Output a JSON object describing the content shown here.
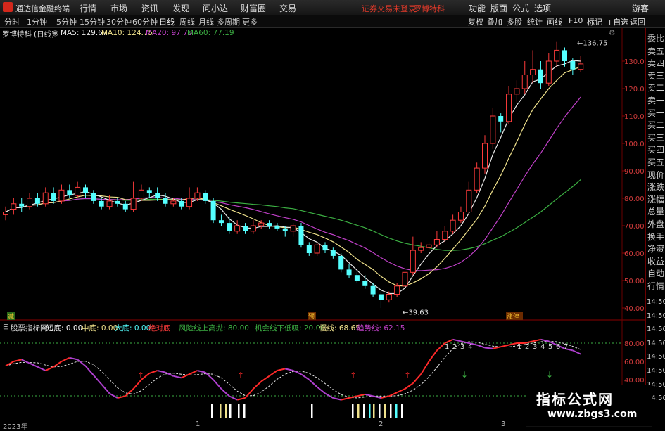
{
  "titlebar": {
    "app_name": "通达信金融终端",
    "menus": [
      "行情",
      "市场",
      "资讯",
      "发现",
      "问小达",
      "财富圈",
      "交易"
    ],
    "status_text": "证券交易未登录",
    "stock_name": "罗博特科",
    "right_menus": [
      "功能",
      "版面",
      "公式",
      "选项"
    ],
    "user": "游客"
  },
  "periods": [
    "分时",
    "1分钟",
    "5分钟",
    "15分钟",
    "30分钟",
    "60分钟",
    "日线",
    "周线",
    "月线",
    "多周期",
    "更多"
  ],
  "active_period": "日线",
  "right_tools": [
    "复权",
    "叠加",
    "多股",
    "统计",
    "画线",
    "F10",
    "标记",
    "+自选",
    "返回"
  ],
  "ma_header": {
    "stock": "罗博特科",
    "period": "(日线)",
    "ma5": "MA5: 129.67",
    "ma10": "MA10: 124.75",
    "ma20": "MA20: 97.75",
    "ma60": "MA60: 77.19"
  },
  "colors": {
    "up": "#ff3b3b",
    "down": "#54ffff",
    "ma5": "#e8e8e8",
    "ma10": "#f0e28c",
    "ma20": "#c040c8",
    "ma60": "#3cb043",
    "grid": "#7a0000"
  },
  "price_axis": [
    "130.00",
    "120.00",
    "110.00",
    "100.00",
    "90.00",
    "80.00",
    "70.00",
    "60.00",
    "50.00",
    "40.00"
  ],
  "price_annotations": {
    "high": "136.75",
    "low": "39.63"
  },
  "event_tags": [
    "减",
    "预",
    "涨停"
  ],
  "indicator_header": {
    "name": "股票指标网",
    "short": "短底: 0.00",
    "mid": "中底: 0.00",
    "big": "大底: 0.00",
    "absolute": "绝对底",
    "risk": "风险线上高抛: 80.00",
    "chance": "机会线下低吸: 20.00",
    "slow": "慢线: 68.65",
    "trend": "趋势线: 62.15"
  },
  "indicator_axis": [
    "80.00",
    "60.00",
    "40.00"
  ],
  "counts_a": [
    "1",
    "2",
    "3",
    "4"
  ],
  "counts_b": [
    "1",
    "2",
    "3",
    "4",
    "5",
    "6",
    "7"
  ],
  "right_panel": [
    "委比",
    "卖五",
    "卖四",
    "卖三",
    "卖二",
    "卖一",
    "买一",
    "买二",
    "买三",
    "买四",
    "买五",
    "现价",
    "涨跌",
    "涨幅",
    "总量",
    "外盘",
    "换手",
    "净资",
    "收益",
    "自动",
    "行情"
  ],
  "time_labels": [
    "14:50",
    "14:50",
    "14:50",
    "14:50",
    "14:50",
    "14:50",
    "14:50",
    "14:50"
  ],
  "timebar": {
    "year": "2023年",
    "m1": "1",
    "m2": "2",
    "m3": "3"
  },
  "watermark": {
    "line1": "指标公式网",
    "line2": "www.zbgs3.com"
  }
}
